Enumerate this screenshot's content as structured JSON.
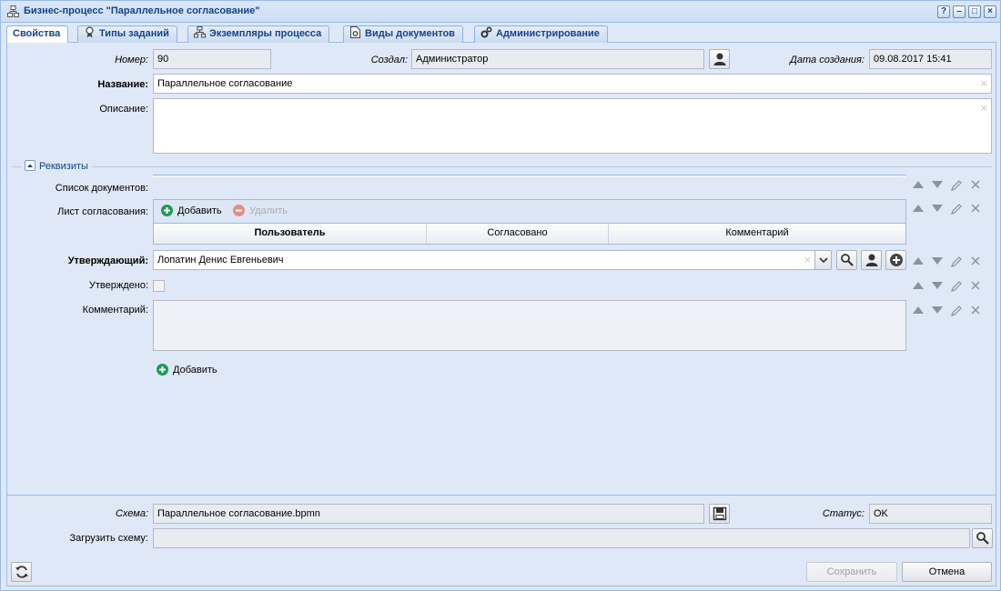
{
  "window": {
    "title": "Бизнес-процесс \"Параллельное согласование\"",
    "buttons": {
      "help": "?",
      "minimize": "–",
      "maximize": "□",
      "close": "×"
    }
  },
  "tabs": [
    {
      "label": "Свойства",
      "icon": "none"
    },
    {
      "label": "Типы заданий",
      "icon": "ribbon-icon"
    },
    {
      "label": "Экземпляры процесса",
      "icon": "hierarchy-icon"
    },
    {
      "label": "Виды документов",
      "icon": "document-gear-icon"
    },
    {
      "label": "Администрирование",
      "icon": "gears-icon"
    }
  ],
  "header": {
    "number_label": "Номер:",
    "number_value": "90",
    "creator_label": "Создал:",
    "creator_value": "Администратор",
    "created_label": "Дата создания:",
    "created_value": "09.08.2017 15:41",
    "name_label": "Название:",
    "name_value": "Параллельное согласование",
    "description_label": "Описание:",
    "description_value": ""
  },
  "requisites": {
    "legend": "Реквизиты",
    "documents_label": "Список документов:",
    "approval_sheet_label": "Лист согласования:",
    "grid_add": "Добавить",
    "grid_delete": "Удалить",
    "grid_columns": [
      "Пользователь",
      "Согласовано",
      "Комментарий"
    ],
    "approver_label": "Утверждающий:",
    "approver_value": "Лопатин Денис Евгеньевич",
    "approved_label": "Утверждено:",
    "approved_checked": false,
    "comment_label": "Комментарий:",
    "comment_value": "",
    "add_label": "Добавить"
  },
  "footer": {
    "scheme_label": "Схема:",
    "scheme_value": "Параллельное согласование.bpmn",
    "status_label": "Статус:",
    "status_value": "OK",
    "upload_label": "Загрузить схему:",
    "upload_value": "",
    "save_label": "Сохранить",
    "cancel_label": "Отмена"
  },
  "colors": {
    "title_text": "#15428b",
    "panel_bg": "#dfe8f6",
    "border": "#99bbe8",
    "add_green": "#1e9a55",
    "delete_red": "#e88a8a"
  }
}
